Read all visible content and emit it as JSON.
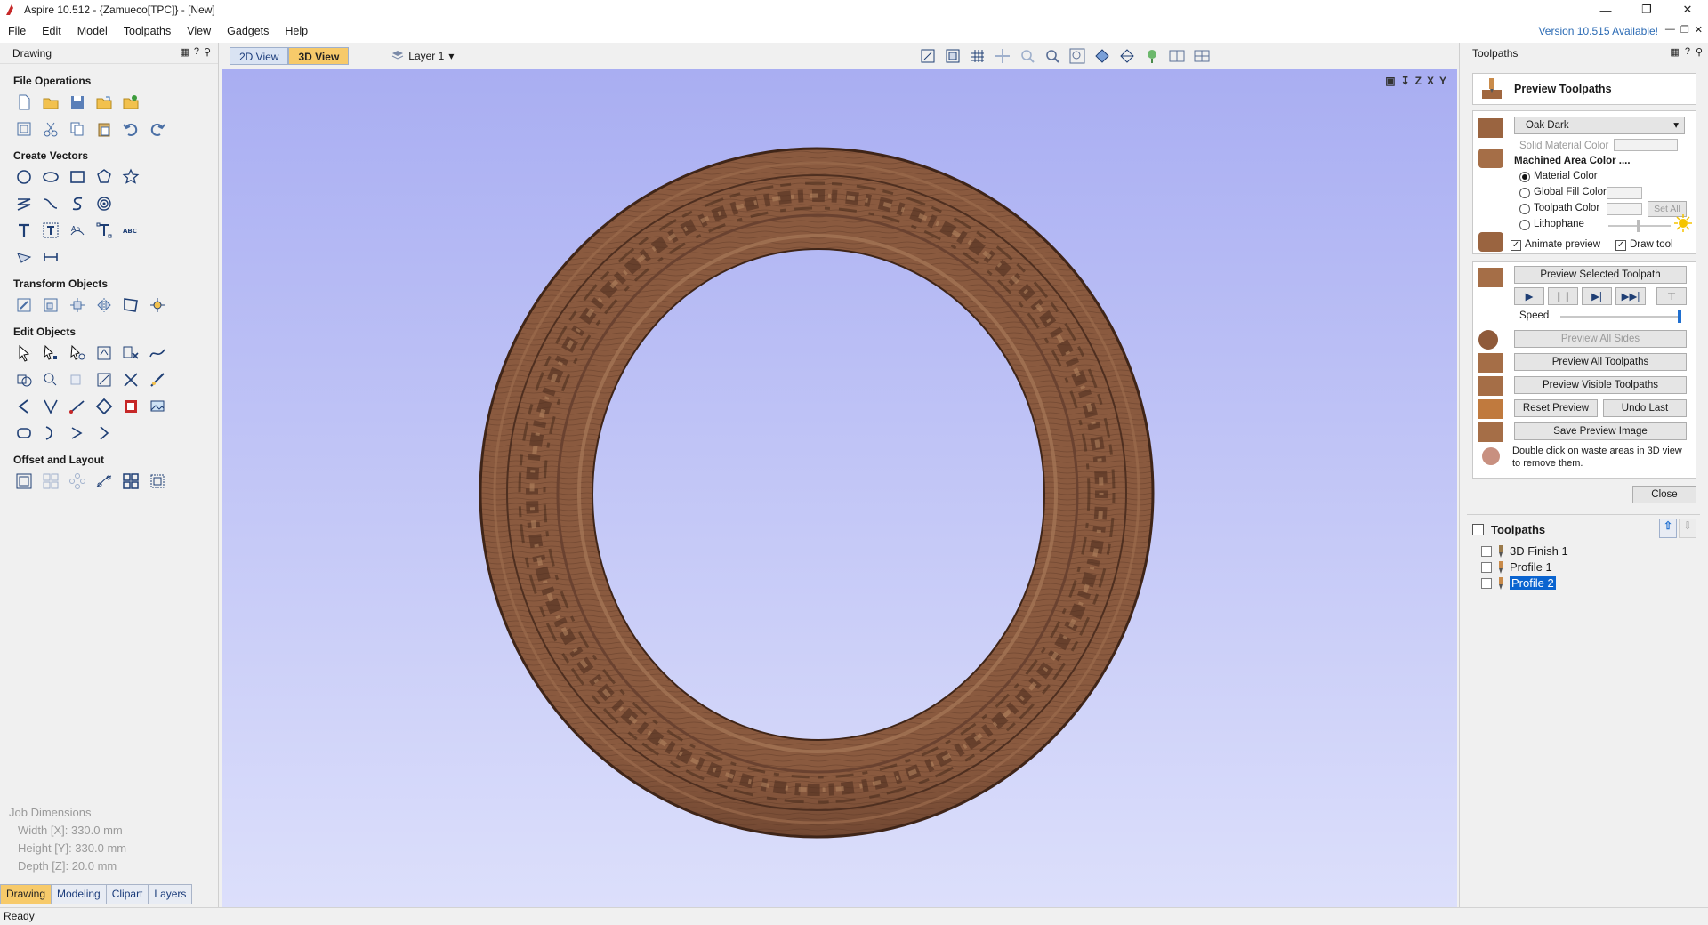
{
  "window": {
    "title": "Aspire 10.512 - {Zamueco[TPC]} - [New]",
    "controls": [
      "minimize",
      "restore",
      "close"
    ]
  },
  "menubar": {
    "items": [
      "File",
      "Edit",
      "Model",
      "Toolpaths",
      "View",
      "Gadgets",
      "Help"
    ],
    "version_notice": "Version 10.515 Available!"
  },
  "left_panel": {
    "title": "Drawing",
    "sections": {
      "file_operations": "File Operations",
      "create_vectors": "Create Vectors",
      "transform_objects": "Transform Objects",
      "edit_objects": "Edit Objects",
      "offset_layout": "Offset and Layout"
    },
    "job_dimensions": {
      "heading": "Job Dimensions",
      "width": "Width  [X]: 330.0 mm",
      "height": "Height [Y]: 330.0 mm",
      "depth": "Depth  [Z]: 20.0 mm"
    },
    "tabs": [
      "Drawing",
      "Modeling",
      "Clipart",
      "Layers"
    ],
    "active_tab": "Drawing"
  },
  "view": {
    "tabs": [
      "2D View",
      "3D View"
    ],
    "active_tab": "3D View",
    "layer": "Layer 1",
    "axis_labels": [
      "Z",
      "X",
      "Y"
    ]
  },
  "right_panel": {
    "title": "Toolpaths",
    "preview": {
      "title": "Preview Toolpaths",
      "material": "Oak Dark",
      "solid_material_color": "Solid Material Color",
      "machined_area_color": "Machined Area Color ....",
      "radio_options": [
        "Material Color",
        "Global Fill Color",
        "Toolpath Color",
        "Lithophane"
      ],
      "selected_radio": "Material Color",
      "set_all": "Set All",
      "animate_preview": "Animate preview",
      "draw_tool": "Draw tool",
      "animate_checked": true,
      "draw_tool_checked": true,
      "preview_selected": "Preview Selected Toolpath",
      "speed_label": "Speed",
      "speed_value": 1.0,
      "preview_all_sides": "Preview All Sides",
      "preview_all_toolpaths": "Preview All Toolpaths",
      "preview_visible_toolpaths": "Preview Visible Toolpaths",
      "reset_preview": "Reset Preview",
      "undo_last": "Undo Last",
      "save_preview_image": "Save Preview Image",
      "hint_line1": "Double click on waste areas in 3D view",
      "hint_line2": "to remove them.",
      "close": "Close"
    },
    "toolpaths_list": {
      "title": "Toolpaths",
      "items": [
        "3D Finish 1",
        "Profile 1",
        "Profile 2"
      ],
      "selected": "Profile 2"
    }
  },
  "statusbar": {
    "text": "Ready"
  },
  "colors": {
    "viewport_top": "#a9aef2",
    "viewport_bottom": "#dcdffb",
    "wood": "#7a4e36",
    "active_tab": "#f7ca6a",
    "selection": "#0a64d0"
  }
}
